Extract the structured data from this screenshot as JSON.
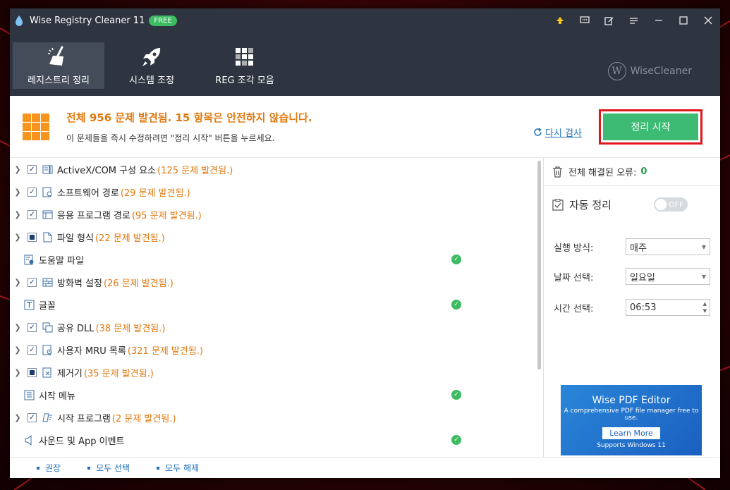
{
  "window": {
    "title": "Wise Registry Cleaner 11",
    "badge": "FREE"
  },
  "toolbar": {
    "tabs": [
      {
        "label": "레지스트리 정리",
        "icon": "broom-icon"
      },
      {
        "label": "시스템 조정",
        "icon": "rocket-icon"
      },
      {
        "label": "REG 조각 모음",
        "icon": "grid-blocks-icon"
      }
    ],
    "brand": "WiseCleaner",
    "brand_mark": "W"
  },
  "banner": {
    "title": "전체 956 문제 발견됨. 15 항목은 안전하지 않습니다.",
    "subtitle": "이 문제들을 즉시 수정하려면 \"정리 시작\" 버튼을 누르세요.",
    "rescan": "다시 검사",
    "start": "정리 시작"
  },
  "list": {
    "items": [
      {
        "label": "ActiveX/COM 구성 요소",
        "count": "(125 문제 발견됨.)"
      },
      {
        "label": "소프트웨어 경로",
        "count": "(29 문제 발견됨.)"
      },
      {
        "label": "응용 프로그램 경로",
        "count": "(95 문제 발견됨.)"
      },
      {
        "label": "파일 형식",
        "count": "(22 문제 발견됨.)"
      },
      {
        "label": "도움말 파일",
        "count": ""
      },
      {
        "label": "방화벽 설정",
        "count": "(26 문제 발견됨.)"
      },
      {
        "label": "글꼴",
        "count": ""
      },
      {
        "label": "공유 DLL",
        "count": "(38 문제 발견됨.)"
      },
      {
        "label": "사용자 MRU 목록",
        "count": "(321 문제 발견됨.)"
      },
      {
        "label": "제거기",
        "count": "(35 문제 발견됨.)"
      },
      {
        "label": "시작 메뉴",
        "count": ""
      },
      {
        "label": "시작 프로그램",
        "count": "(2 문제 발견됨.)"
      },
      {
        "label": "사운드 및 App 이벤트",
        "count": ""
      }
    ]
  },
  "side": {
    "resolved_label": "전체 해결된 오류:",
    "resolved_value": "0",
    "auto_clean": "자동 정리",
    "toggle": "OFF",
    "run_label": "실행 방식:",
    "run_value": "매주",
    "day_label": "날짜 선택:",
    "day_value": "일요일",
    "time_label": "시간 선택:",
    "time_value": "06:53"
  },
  "ad": {
    "title": "Wise PDF Editor",
    "subtitle": "A comprehensive PDF file manager free to use.",
    "button": "Learn More",
    "footer": "Supports Windows 11"
  },
  "footer": {
    "recommend": "권장",
    "select_all": "모두 선택",
    "deselect_all": "모두 해제"
  },
  "colors": {
    "titlebar": "#2e3440",
    "accent_green": "#3dbb74",
    "warning_orange": "#e07a10",
    "highlight_red": "#e0161c",
    "link_blue": "#1d6fb8"
  }
}
